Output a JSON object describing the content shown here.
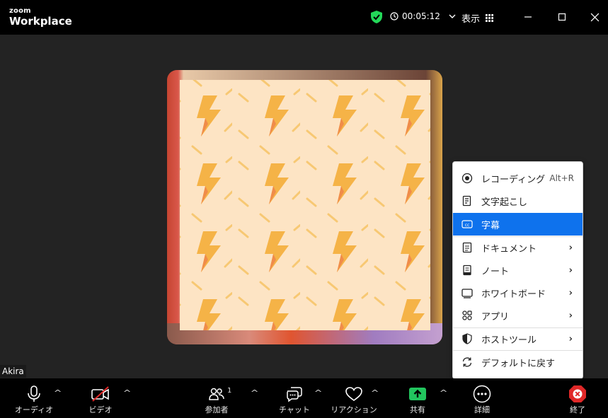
{
  "app": {
    "logo_top": "zoom",
    "logo_bottom": "Workplace"
  },
  "titlebar": {
    "timer": "00:05:12",
    "view_label": "表示",
    "icons": [
      "security-shield-icon",
      "clock-icon",
      "chevron-down-icon",
      "grid-icon",
      "minimize-icon",
      "maximize-icon",
      "close-icon"
    ]
  },
  "colors": {
    "accent": "#0e72ed",
    "security_green": "#23d959",
    "share_green": "#22c55e",
    "end_red": "#e02828",
    "placeholder_bg": "#fde4c4",
    "bolt": "#f5b347"
  },
  "participant": {
    "name": "Akira"
  },
  "menu": {
    "items": [
      {
        "label": "レコーディング",
        "shortcut": "Alt+R",
        "icon": "record-icon",
        "submenu": false
      },
      {
        "label": "文字起こし",
        "shortcut": "",
        "icon": "transcript-icon",
        "submenu": false
      },
      {
        "label": "字幕",
        "shortcut": "",
        "icon": "captions-icon",
        "submenu": false,
        "active": true
      },
      {
        "label": "ドキュメント",
        "shortcut": "",
        "icon": "document-icon",
        "submenu": true
      },
      {
        "label": "ノート",
        "shortcut": "",
        "icon": "notes-icon",
        "submenu": true
      },
      {
        "label": "ホワイトボード",
        "shortcut": "",
        "icon": "whiteboard-icon",
        "submenu": true
      },
      {
        "label": "アプリ",
        "shortcut": "",
        "icon": "apps-icon",
        "submenu": true
      },
      {
        "label": "ホストツール",
        "shortcut": "",
        "icon": "shield-icon",
        "submenu": true
      },
      {
        "label": "デフォルトに戻す",
        "shortcut": "",
        "icon": "reset-icon",
        "submenu": false
      }
    ],
    "arrow": "›"
  },
  "toolbar": {
    "audio_label": "オーディオ",
    "video_label": "ビデオ",
    "participants_label": "参加者",
    "participants_count": "1",
    "chat_label": "チャット",
    "reactions_label": "リアクション",
    "share_label": "共有",
    "more_label": "詳細",
    "end_label": "終了",
    "caret": "^"
  }
}
